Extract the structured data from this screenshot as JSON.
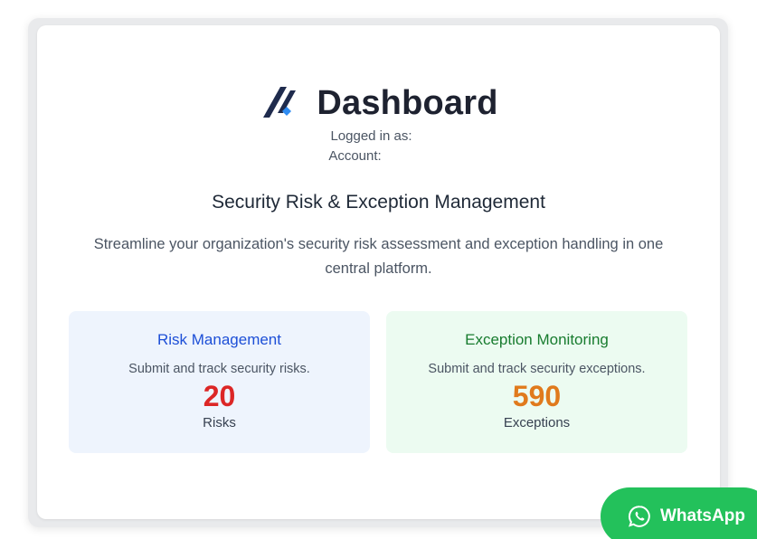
{
  "header": {
    "title": "Dashboard",
    "logo_icon": "double-slash-logo-icon"
  },
  "meta": {
    "logged_in_label": "Logged in as:",
    "account_label": "Account:"
  },
  "intro": {
    "subtitle": "Security Risk & Exception Management",
    "description": "Streamline your organization's security risk assessment and exception handling in one central platform."
  },
  "tiles": [
    {
      "title": "Risk Management",
      "subtitle": "Submit and track security risks.",
      "count": "20",
      "unit": "Risks",
      "title_color": "#1d4fd7",
      "count_color": "#dc2626",
      "background": "#eef4fd"
    },
    {
      "title": "Exception Monitoring",
      "subtitle": "Submit and track security exceptions.",
      "count": "590",
      "unit": "Exceptions",
      "title_color": "#187c2f",
      "count_color": "#e07a1c",
      "background": "#ecfbf1"
    }
  ],
  "whatsapp": {
    "label": "WhatsApp",
    "icon": "whatsapp-icon",
    "color": "#23c15b"
  }
}
